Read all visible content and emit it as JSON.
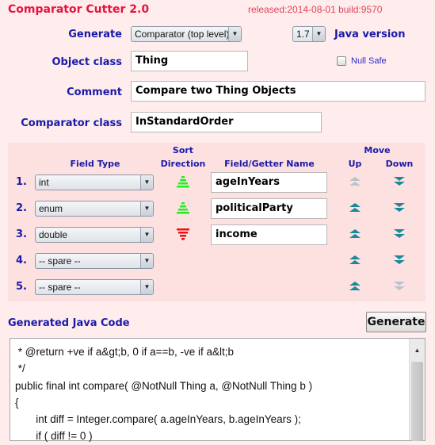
{
  "app": {
    "title": "Comparator Cutter 2.0",
    "release": "released:2014-08-01 build:9570"
  },
  "form": {
    "generate_label": "Generate",
    "generate_value": "Comparator (top level)",
    "java_version_value": "1.7",
    "java_version_label": "Java version",
    "object_class_label": "Object class",
    "object_class_value": "Thing",
    "null_safe_label": "Null Safe",
    "null_safe_checked": false,
    "comment_label": "Comment",
    "comment_value": "Compare two Thing Objects",
    "comparator_class_label": "Comparator class",
    "comparator_class_value": "InStandardOrder"
  },
  "fields": {
    "headers": {
      "field_type": "Field Type",
      "sort": "Sort",
      "direction": "Direction",
      "name": "Field/Getter Name",
      "move": "Move",
      "up": "Up",
      "down": "Down"
    },
    "rows": [
      {
        "num": "1.",
        "type": "int",
        "direction": "ascending",
        "name": "ageInYears",
        "up_enabled": false,
        "down_enabled": true
      },
      {
        "num": "2.",
        "type": "enum",
        "direction": "ascending",
        "name": "politicalParty",
        "up_enabled": true,
        "down_enabled": true
      },
      {
        "num": "3.",
        "type": "double",
        "direction": "descending",
        "name": "income",
        "up_enabled": true,
        "down_enabled": true
      },
      {
        "num": "4.",
        "type": "-- spare --",
        "direction": null,
        "name": null,
        "up_enabled": true,
        "down_enabled": true
      },
      {
        "num": "5.",
        "type": "-- spare --",
        "direction": null,
        "name": null,
        "up_enabled": true,
        "down_enabled": false
      }
    ]
  },
  "output": {
    "label": "Generated Java Code",
    "generate_button": "Generate",
    "code": " * @return +ve if a&gt;b, 0 if a==b, -ve if a&lt;b\n */\npublic final int compare( @NotNull Thing a, @NotNull Thing b )\n{\n       int diff = Integer.compare( a.ageInYears, b.ageInYears );\n       if ( diff != 0 )"
  },
  "colors": {
    "ascending": "#22ee22",
    "descending": "#ee1111",
    "move": "#1a8a9a",
    "label": "#1a1aa8",
    "title": "#e8123e"
  }
}
